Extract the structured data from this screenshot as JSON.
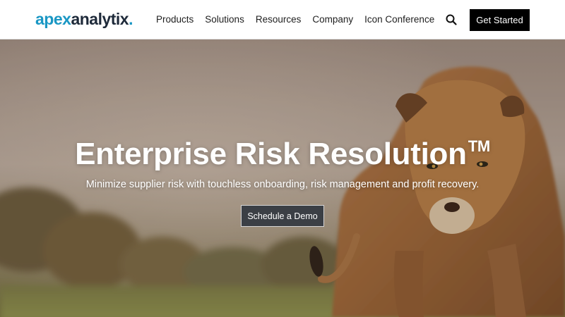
{
  "header": {
    "logo": {
      "part1": "apex",
      "part2": "analytix",
      "dot": "."
    },
    "nav": [
      "Products",
      "Solutions",
      "Resources",
      "Company",
      "Icon Conference"
    ],
    "search_icon": "search-icon",
    "cta_label": "Get Started"
  },
  "hero": {
    "title": "Enterprise Risk Resolution",
    "title_mark": "TM",
    "subtitle": "Minimize supplier risk with touchless onboarding, risk management and profit recovery.",
    "button_label": "Schedule a Demo",
    "background": "lioness-walking-savanna-photo"
  },
  "colors": {
    "brand_blue": "#1a97c4",
    "brand_dark": "#1e2a3a",
    "cta_bg": "#000000",
    "demo_bg": "#3b3f45"
  }
}
